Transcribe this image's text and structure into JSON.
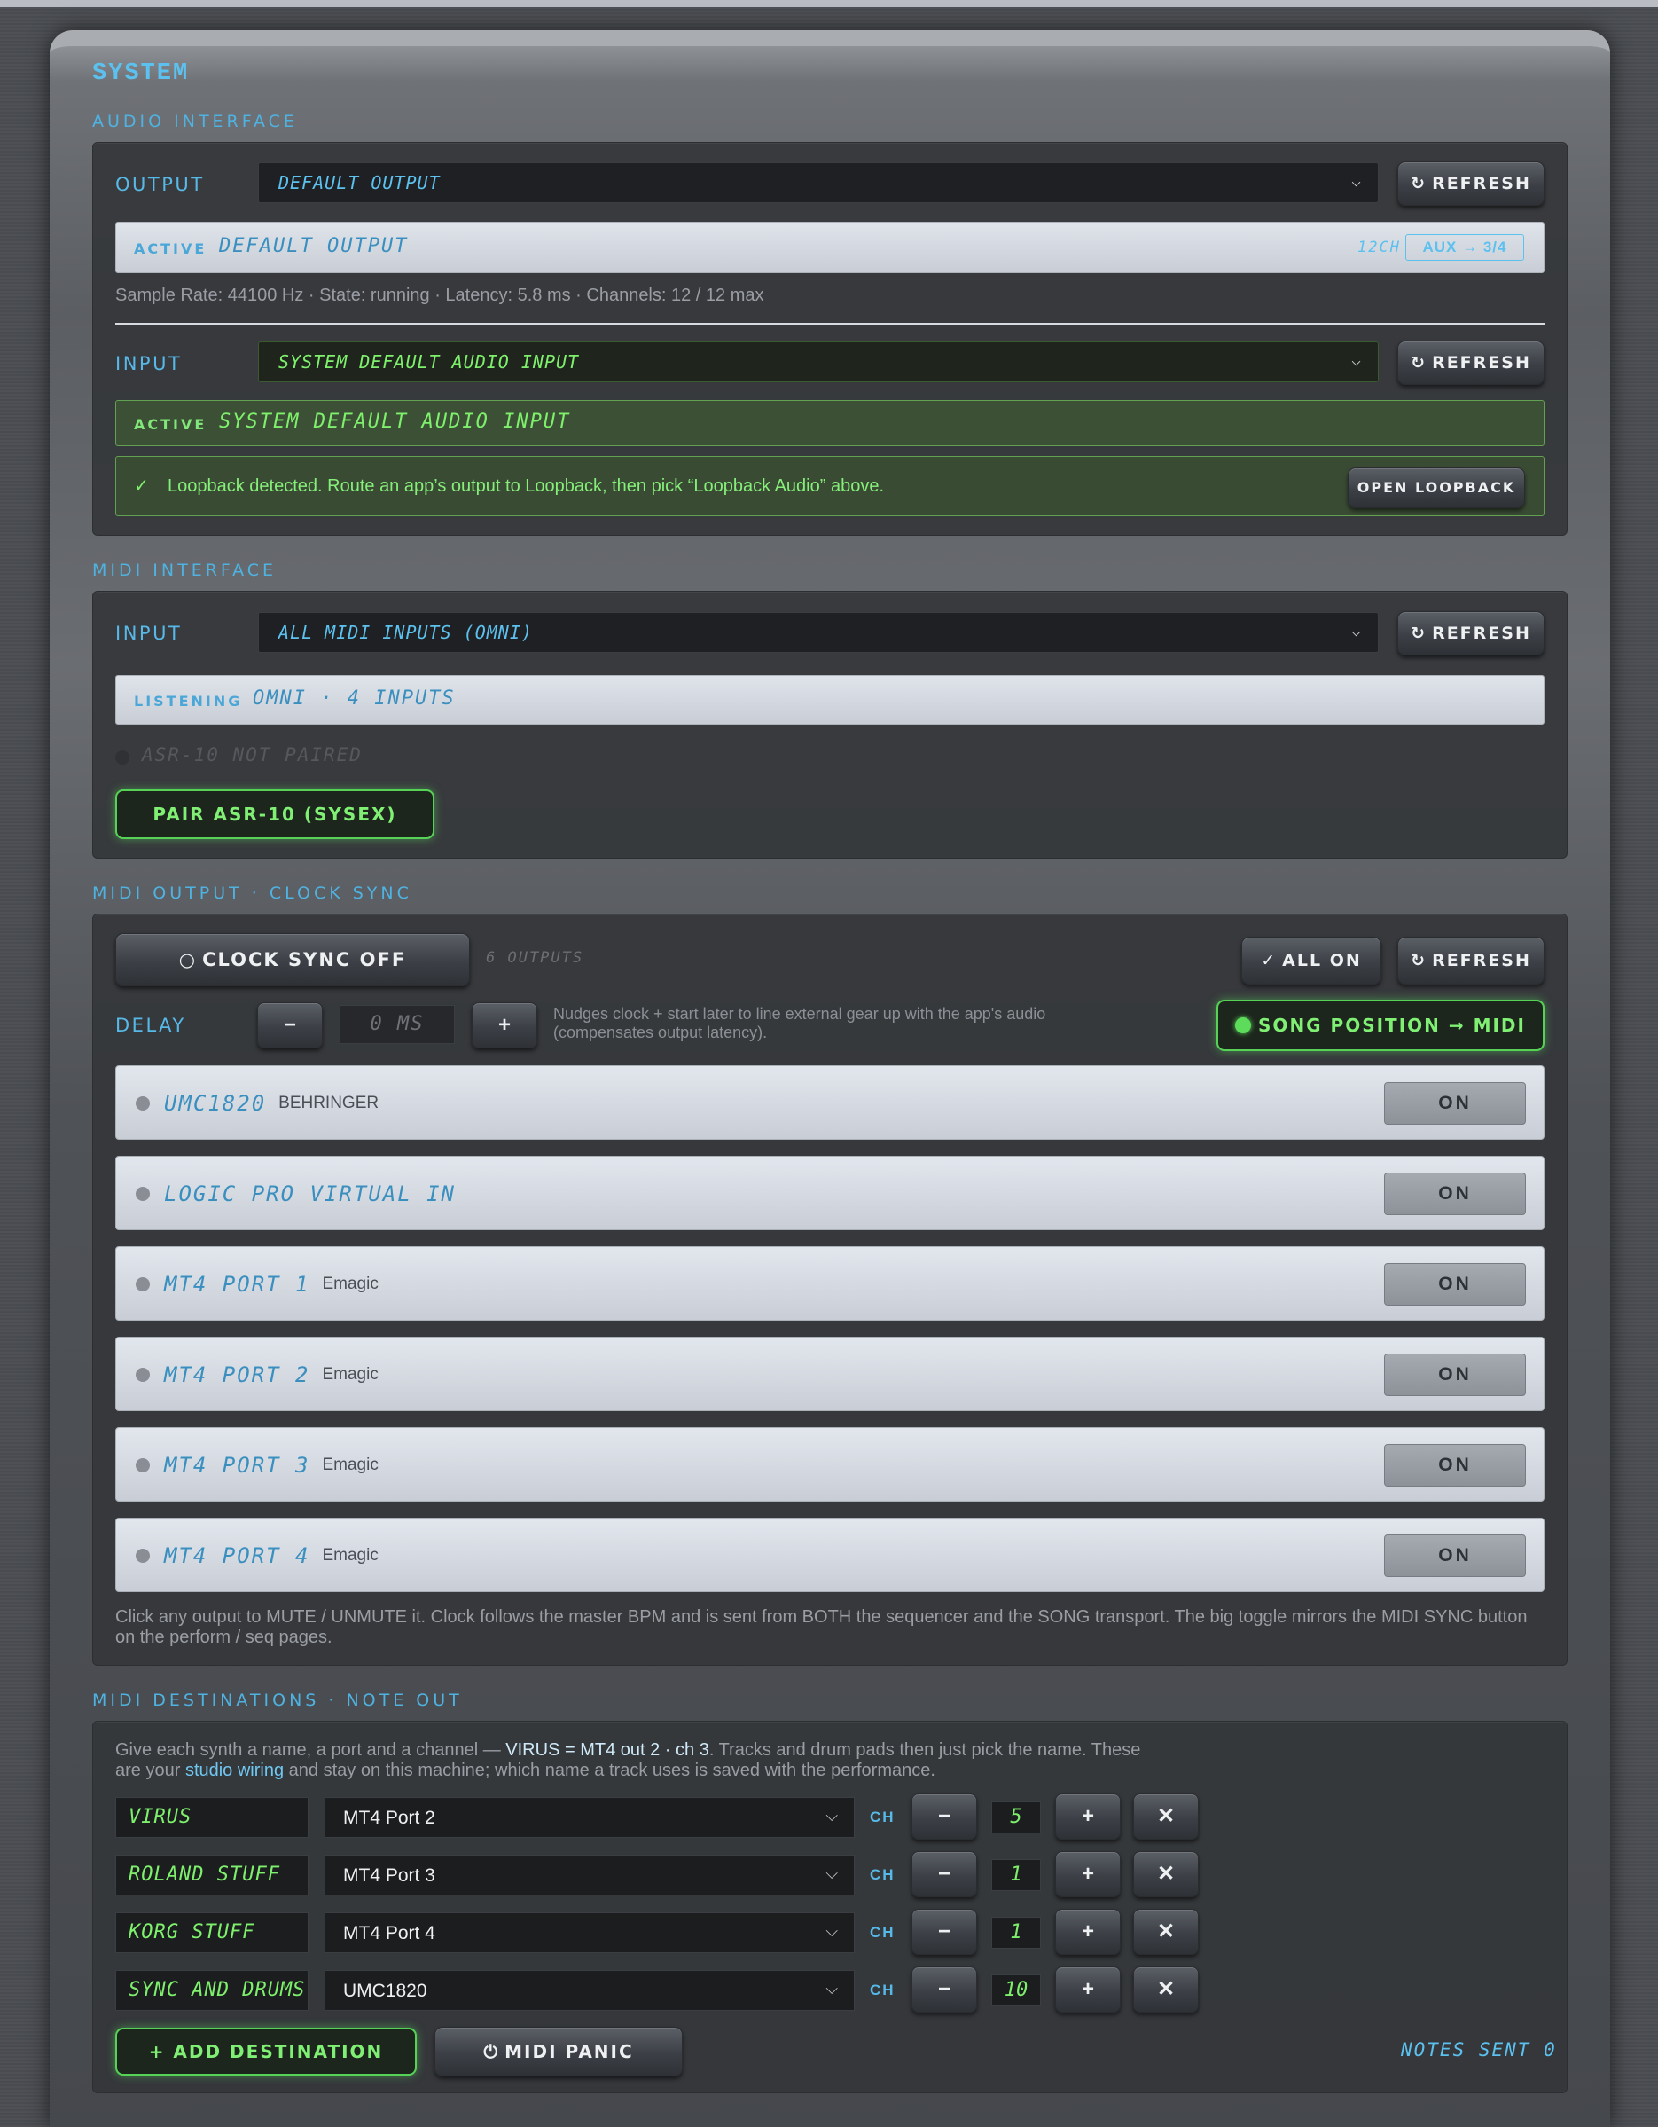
{
  "title": "SYSTEM",
  "audio": {
    "section_label": "AUDIO INTERFACE",
    "output_label": "OUTPUT",
    "output_value": "DEFAULT OUTPUT",
    "refresh": "REFRESH",
    "active_tag": "ACTIVE",
    "active_output": "DEFAULT OUTPUT",
    "channels_badge": "12CH",
    "aux_badge": "AUX → 3/4",
    "meta": "Sample Rate: 44100 Hz · State: running · Latency: 5.8 ms · Channels: 12 / 12 max",
    "input_label": "INPUT",
    "input_value": "SYSTEM DEFAULT AUDIO INPUT",
    "active_input": "SYSTEM DEFAULT AUDIO INPUT",
    "loopback_check": "✓",
    "loopback_msg": "Loopback detected. Route an app’s output to Loopback, then pick “Loopback Audio” above.",
    "open_loopback": "OPEN LOOPBACK"
  },
  "midi_in": {
    "section_label": "MIDI INTERFACE",
    "input_label": "INPUT",
    "input_value": "ALL MIDI INPUTS (OMNI)",
    "refresh": "REFRESH",
    "listening_tag": "LISTENING",
    "listening_value": "OMNI · 4 INPUTS",
    "asr_status": "ASR-10 NOT PAIRED",
    "pair_button": "PAIR ASR-10 (SYSEX)"
  },
  "midi_out": {
    "section_label": "MIDI OUTPUT · CLOCK SYNC",
    "clock_button": "CLOCK SYNC OFF",
    "outputs_count": "6 OUTPUTS",
    "all_on": "ALL ON",
    "refresh": "REFRESH",
    "delay_label": "DELAY",
    "minus": "−",
    "plus": "+",
    "delay_value": "0 MS",
    "delay_help": "Nudges clock + start later to line external gear up with the app's audio (compensates output latency).",
    "song_position": "SONG POSITION → MIDI",
    "outputs": [
      {
        "name": "UMC1820",
        "maker": "BEHRINGER",
        "toggle": "ON"
      },
      {
        "name": "LOGIC PRO VIRTUAL IN",
        "maker": "",
        "toggle": "ON"
      },
      {
        "name": "MT4 PORT 1",
        "maker": "Emagic",
        "toggle": "ON"
      },
      {
        "name": "MT4 PORT 2",
        "maker": "Emagic",
        "toggle": "ON"
      },
      {
        "name": "MT4 PORT 3",
        "maker": "Emagic",
        "toggle": "ON"
      },
      {
        "name": "MT4 PORT 4",
        "maker": "Emagic",
        "toggle": "ON"
      }
    ],
    "footer_help": "Click any output to MUTE / UNMUTE it. Clock follows the master BPM and is sent from BOTH the sequencer and the SONG transport. The big toggle mirrors the MIDI SYNC button on the perform / seq pages."
  },
  "destinations": {
    "section_label": "MIDI DESTINATIONS · NOTE OUT",
    "help_1": "Give each synth a name, a port and a channel —",
    "help_example": "VIRUS = MT4 out 2 · ch 3",
    "help_2": ". Tracks and drum pads then just pick the name. These",
    "help_3": "are your",
    "help_link": "studio wiring",
    "help_4": "and stay on this machine; which name a track uses is saved with the performance.",
    "ch_label": "CH",
    "minus": "−",
    "plus": "+",
    "remove": "✕",
    "rows": [
      {
        "name": "VIRUS",
        "port": "MT4 Port 2",
        "channel": "5"
      },
      {
        "name": "ROLAND STUFF",
        "port": "MT4 Port 3",
        "channel": "1"
      },
      {
        "name": "KORG STUFF",
        "port": "MT4 Port 4",
        "channel": "1"
      },
      {
        "name": "SYNC AND DRUMS",
        "port": "UMC1820",
        "channel": "10"
      }
    ],
    "add_button": "+ ADD DESTINATION",
    "panic_button": "MIDI PANIC",
    "notes_sent": "NOTES SENT 0"
  },
  "colors": {
    "accent_blue": "#5cc1ee",
    "lcd_green": "#7ef06c",
    "glow_green": "#56d357"
  }
}
